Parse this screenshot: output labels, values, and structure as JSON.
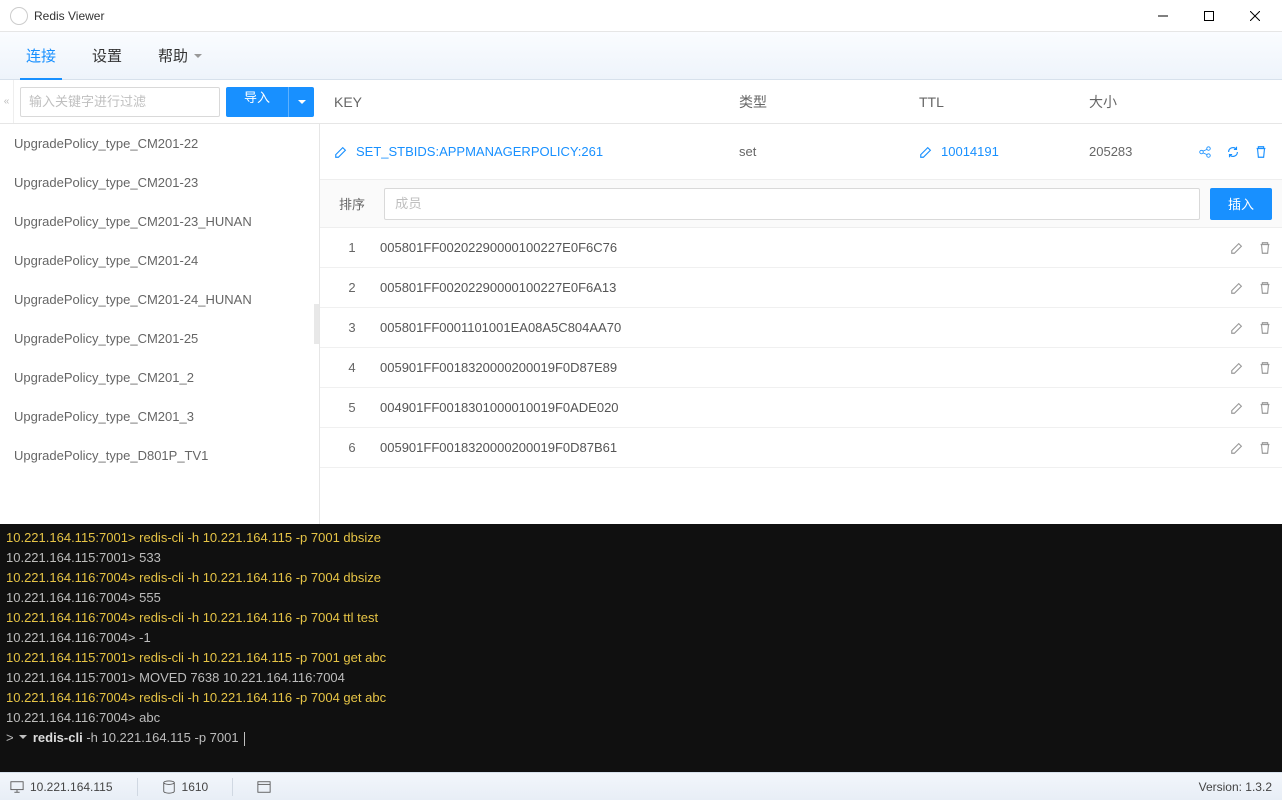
{
  "window": {
    "title": "Redis Viewer"
  },
  "menu": {
    "connect": "连接",
    "settings": "设置",
    "help": "帮助"
  },
  "sidebar": {
    "filter_placeholder": "输入关键字进行过滤",
    "import_label": "导入",
    "items": [
      "UpgradePolicy_type_CM201-22",
      "UpgradePolicy_type_CM201-23",
      "UpgradePolicy_type_CM201-23_HUNAN",
      "UpgradePolicy_type_CM201-24",
      "UpgradePolicy_type_CM201-24_HUNAN",
      "UpgradePolicy_type_CM201-25",
      "UpgradePolicy_type_CM201_2",
      "UpgradePolicy_type_CM201_3",
      "UpgradePolicy_type_D801P_TV1"
    ]
  },
  "header": {
    "key": "KEY",
    "type": "类型",
    "ttl": "TTL",
    "size": "大小"
  },
  "detail": {
    "key": "SET_STBIDS:APPMANAGERPOLICY:261",
    "type": "set",
    "ttl": "10014191",
    "size": "205283"
  },
  "members": {
    "sort_label": "排序",
    "member_placeholder": "成员",
    "insert_label": "插入",
    "rows": [
      {
        "idx": "1",
        "val": "005801FF00202290000100227E0F6C76"
      },
      {
        "idx": "2",
        "val": "005801FF00202290000100227E0F6A13"
      },
      {
        "idx": "3",
        "val": "005801FF0001101001EA08A5C804AA70"
      },
      {
        "idx": "4",
        "val": "005901FF0018320000200019F0D87E89"
      },
      {
        "idx": "5",
        "val": "004901FF0018301000010019F0ADE020"
      },
      {
        "idx": "6",
        "val": "005901FF0018320000200019F0D87B61"
      }
    ]
  },
  "terminal": {
    "lines": [
      {
        "p": "10.221.164.115:7001> ",
        "cmd": "redis-cli -h 10.221.164.115 -p 7001 dbsize"
      },
      {
        "p": "10.221.164.115:7001> ",
        "out": "533"
      },
      {
        "p": "10.221.164.116:7004> ",
        "cmd": "redis-cli -h 10.221.164.116 -p 7004 dbsize"
      },
      {
        "p": "10.221.164.116:7004> ",
        "out": "555"
      },
      {
        "p": "10.221.164.116:7004> ",
        "cmd": "redis-cli -h 10.221.164.116 -p 7004 ttl test"
      },
      {
        "p": "10.221.164.116:7004> ",
        "out": "-1"
      },
      {
        "p": "10.221.164.115:7001> ",
        "cmd": "redis-cli -h 10.221.164.115 -p 7001 get abc"
      },
      {
        "p": "10.221.164.115:7001> ",
        "out": "MOVED 7638 10.221.164.116:7004"
      },
      {
        "p": "10.221.164.116:7004> ",
        "cmd": "redis-cli -h 10.221.164.116 -p 7004 get abc"
      },
      {
        "p": "10.221.164.116:7004> ",
        "out": "abc"
      }
    ],
    "input_prefix": "> ",
    "input_cmd_bold": "redis-cli",
    "input_cmd_rest": " -h 10.221.164.115 -p 7001 "
  },
  "status": {
    "host": "10.221.164.115",
    "db_count": "1610",
    "version": "Version: 1.3.2"
  }
}
